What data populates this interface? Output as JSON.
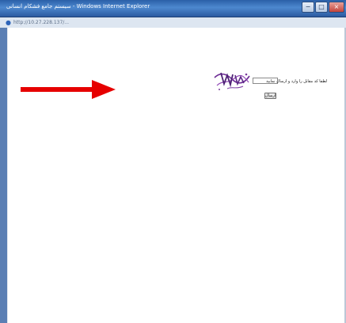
{
  "window": {
    "title": "سیستم جامع فشكام انسانی - Windows Internet Explorer",
    "minimize_label": "−",
    "maximize_label": "□",
    "close_label": "×"
  },
  "addressbar": {
    "url": "http://10.27.228.137/..."
  },
  "form": {
    "prompt": "لطفا کد مقابل را وارد و ارسال نمایید",
    "captcha_value": "",
    "submit_label": "ارسال"
  },
  "colors": {
    "arrow": "#e60000",
    "titlebar": "#3d73bf",
    "captcha": "#7a3a9c"
  },
  "icons": {
    "browser": "ie-icon",
    "arrow": "red-arrow-right"
  }
}
